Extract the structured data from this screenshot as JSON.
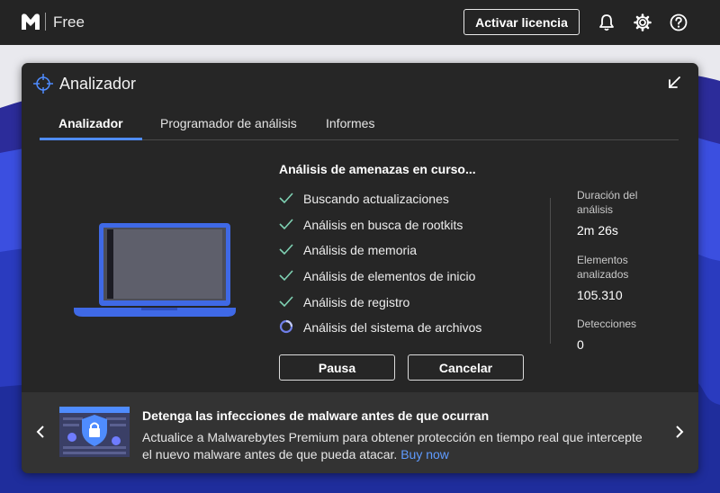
{
  "app": {
    "edition": "Free",
    "license_button": "Activar licencia"
  },
  "icons": {
    "logo": "malwarebytes-logo-icon",
    "notifications": "bell-icon",
    "settings": "gear-icon",
    "help": "help-icon",
    "panel": "crosshair-icon",
    "collapse": "arrow-down-left-icon"
  },
  "colors": {
    "accent": "#4f8cff",
    "panel_bg": "#262626",
    "check": "#7fd1b3",
    "link": "#5f9bff",
    "wave_blue": "#3b4fe0"
  },
  "panel": {
    "title": "Analizador",
    "tabs": [
      {
        "label": "Analizador",
        "active": true
      },
      {
        "label": "Programador de análisis",
        "active": false
      },
      {
        "label": "Informes",
        "active": false
      }
    ]
  },
  "scan": {
    "title": "Análisis de amenazas en curso...",
    "steps": [
      {
        "label": "Buscando actualizaciones",
        "status": "done"
      },
      {
        "label": "Análisis en busca de rootkits",
        "status": "done"
      },
      {
        "label": "Análisis de memoria",
        "status": "done"
      },
      {
        "label": "Análisis de elementos de inicio",
        "status": "done"
      },
      {
        "label": "Análisis de registro",
        "status": "done"
      },
      {
        "label": "Análisis del sistema de archivos",
        "status": "in-progress"
      }
    ],
    "stats": [
      {
        "label": "Duración del análisis",
        "value": "2m 26s"
      },
      {
        "label": "Elementos analizados",
        "value": "105.310"
      },
      {
        "label": "Detecciones",
        "value": "0"
      }
    ],
    "pause_button": "Pausa",
    "cancel_button": "Cancelar"
  },
  "promo": {
    "title": "Detenga las infecciones de malware antes de que ocurran",
    "text": "Actualice a Malwarebytes Premium para obtener protección en tiempo real que intercepte el nuevo malware antes de que pueda atacar.",
    "link": "Buy now"
  }
}
